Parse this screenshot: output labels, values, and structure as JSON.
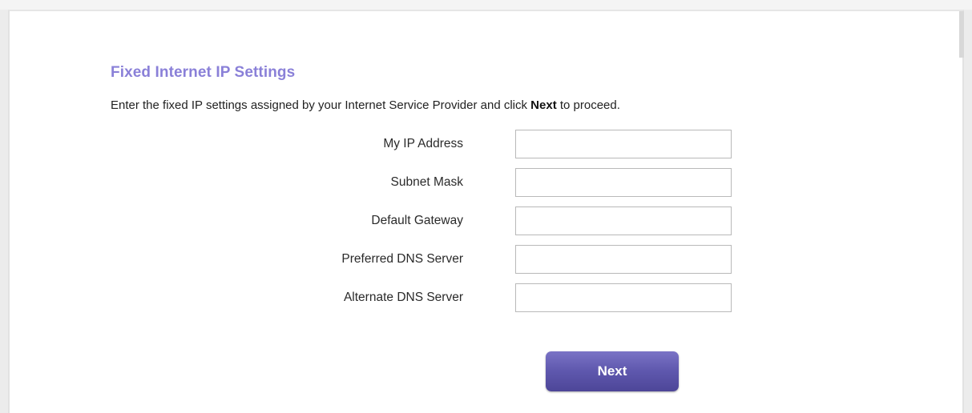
{
  "page": {
    "title": "Fixed Internet IP Settings",
    "instruction_prefix": "Enter the fixed IP settings assigned by your Internet Service Provider and click ",
    "instruction_bold": "Next",
    "instruction_suffix": " to proceed."
  },
  "fields": [
    {
      "label": "My IP Address",
      "value": "",
      "placeholder": ""
    },
    {
      "label": "Subnet Mask",
      "value": "",
      "placeholder": ""
    },
    {
      "label": "Default Gateway",
      "value": "",
      "placeholder": ""
    },
    {
      "label": "Preferred DNS Server",
      "value": "",
      "placeholder": ""
    },
    {
      "label": "Alternate DNS Server",
      "value": "",
      "placeholder": ""
    }
  ],
  "actions": {
    "next_label": "Next"
  },
  "colors": {
    "title": "#8a80d8",
    "button": "#5f58ae"
  }
}
